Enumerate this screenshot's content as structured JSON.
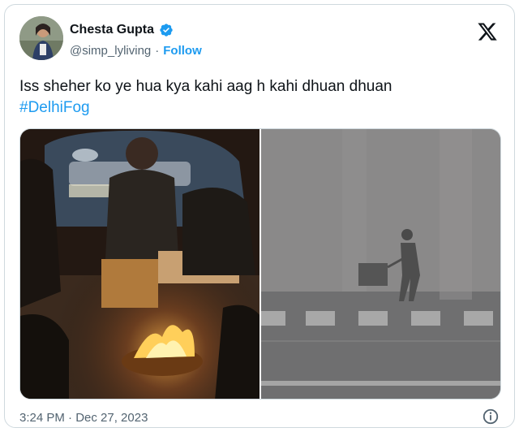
{
  "user": {
    "display_name": "Chesta Gupta",
    "handle": "@simp_lyliving",
    "separator": "·",
    "follow_label": "Follow",
    "verified_icon": "verified-badge-icon"
  },
  "tweet": {
    "text": "Iss sheher ko ye hua kya kahi aag h kahi dhuan dhuan",
    "hashtag": "#DelhiFog",
    "timestamp": "3:24 PM · Dec 27, 2023"
  },
  "media": {
    "left_photo": "people-around-fire-photo",
    "right_photo": "foggy-street-photo"
  },
  "colors": {
    "accent": "#1d9bf0",
    "secondary_text": "#536471",
    "border": "#cfd9de"
  },
  "icons": {
    "logo": "x-logo-icon",
    "info": "info-icon"
  }
}
